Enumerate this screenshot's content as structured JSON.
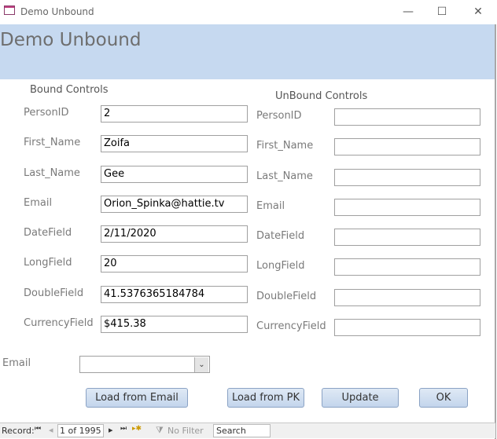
{
  "window": {
    "title": "Demo Unbound",
    "minimize": "—",
    "maximize": "☐",
    "close": "✕"
  },
  "header": {
    "title": "Demo Unbound"
  },
  "bound": {
    "heading": "Bound Controls",
    "fields": [
      {
        "label": "PersonID",
        "value": "2"
      },
      {
        "label": "First_Name",
        "value": "Zoifa"
      },
      {
        "label": "Last_Name",
        "value": "Gee"
      },
      {
        "label": "Email",
        "value": "Orion_Spinka@hattie.tv"
      },
      {
        "label": "DateField",
        "value": "2/11/2020"
      },
      {
        "label": "LongField",
        "value": "20"
      },
      {
        "label": "DoubleField",
        "value": "41.5376365184784"
      },
      {
        "label": "CurrencyField",
        "value": "$415.38"
      }
    ]
  },
  "unbound": {
    "heading": "UnBound Controls",
    "fields": [
      {
        "label": "PersonID",
        "value": ""
      },
      {
        "label": "First_Name",
        "value": ""
      },
      {
        "label": "Last_Name",
        "value": ""
      },
      {
        "label": "Email",
        "value": ""
      },
      {
        "label": "DateField",
        "value": ""
      },
      {
        "label": "LongField",
        "value": ""
      },
      {
        "label": "DoubleField",
        "value": ""
      },
      {
        "label": "CurrencyField",
        "value": ""
      }
    ]
  },
  "email_combo": {
    "label": "Email",
    "value": ""
  },
  "buttons": {
    "load_email": "Load from Email",
    "load_pk": "Load from PK",
    "update": "Update",
    "ok": "OK"
  },
  "status": {
    "record_label": "Record:",
    "first": "⏮",
    "prev": "◂",
    "position": "1 of 1995",
    "next": "▸",
    "last": "⏭",
    "new": "▸✱",
    "filter": "No Filter",
    "search": "Search"
  }
}
